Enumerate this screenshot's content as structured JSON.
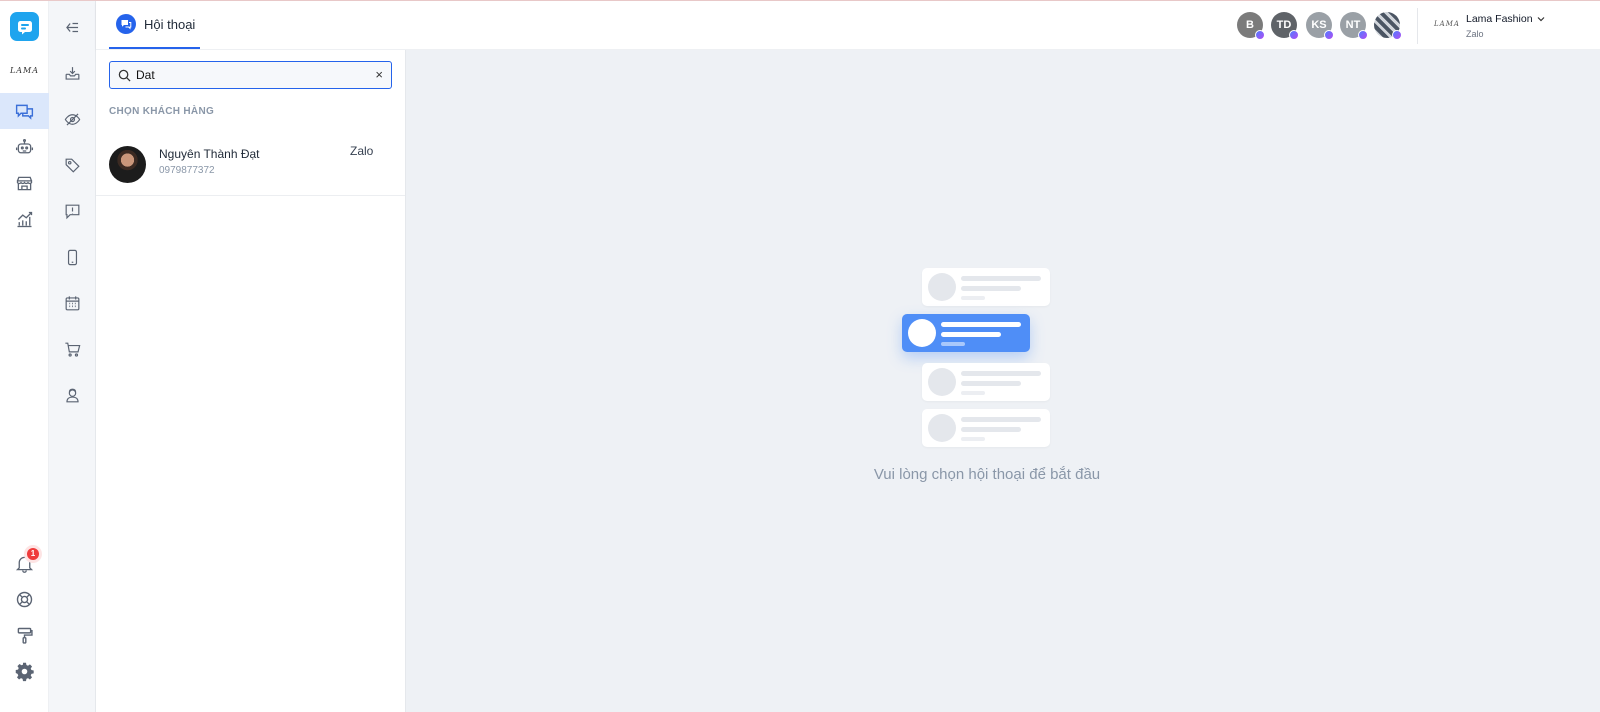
{
  "rail": {
    "brand": "LAMA",
    "notification_count": "1"
  },
  "header": {
    "tab_label": "Hội thoại",
    "page_avatars": [
      {
        "initials": "B",
        "color": "#7b7b7b"
      },
      {
        "initials": "TD",
        "color": "#5f6368"
      },
      {
        "initials": "KS",
        "color": "#9aa0a6"
      },
      {
        "initials": "NT",
        "color": "#9aa0a6"
      },
      {
        "initials": "",
        "color": "#4b5563"
      }
    ],
    "account_logo": "LAMA",
    "account_name": "Lama Fashion",
    "account_channel": "Zalo"
  },
  "search": {
    "value": "Dat",
    "clear_label": "×"
  },
  "results": {
    "section_title": "CHỌN KHÁCH HÀNG",
    "customers": [
      {
        "name": "Nguyên Thành Đạt",
        "phone": "0979877372",
        "channel": "Zalo"
      }
    ]
  },
  "main": {
    "empty_message": "Vui lòng chọn hội thoại để bắt đầu"
  },
  "colors": {
    "accent": "#2563eb",
    "app_logo": "#1fa4ee",
    "badge": "#ef3b3b",
    "illustration_highlight": "#4f8ef7"
  }
}
